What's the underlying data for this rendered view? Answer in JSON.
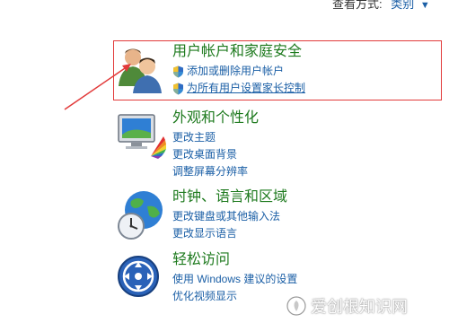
{
  "view_by": {
    "label": "查看方式:",
    "value": "类别"
  },
  "categories": [
    {
      "title": "用户帐户和家庭安全",
      "icon": "users-icon",
      "links": [
        {
          "label": "添加或删除用户帐户",
          "shield": true
        },
        {
          "label": "为所有用户设置家长控制",
          "shield": true
        }
      ]
    },
    {
      "title": "外观和个性化",
      "icon": "appearance-icon",
      "links": [
        {
          "label": "更改主题"
        },
        {
          "label": "更改桌面背景"
        },
        {
          "label": "调整屏幕分辨率"
        }
      ]
    },
    {
      "title": "时钟、语言和区域",
      "icon": "clock-globe-icon",
      "links": [
        {
          "label": "更改键盘或其他输入法"
        },
        {
          "label": "更改显示语言"
        }
      ]
    },
    {
      "title": "轻松访问",
      "icon": "ease-of-access-icon",
      "links": [
        {
          "label": "使用 Windows 建议的设置"
        },
        {
          "label": "优化视频显示"
        }
      ]
    }
  ],
  "watermark": {
    "text": "爱创根知识网",
    "icon": "watermark-logo-icon"
  },
  "colors": {
    "title_green": "#1e7a1e",
    "link_blue": "#1b5fa6",
    "highlight_red": "#e23a3a"
  }
}
